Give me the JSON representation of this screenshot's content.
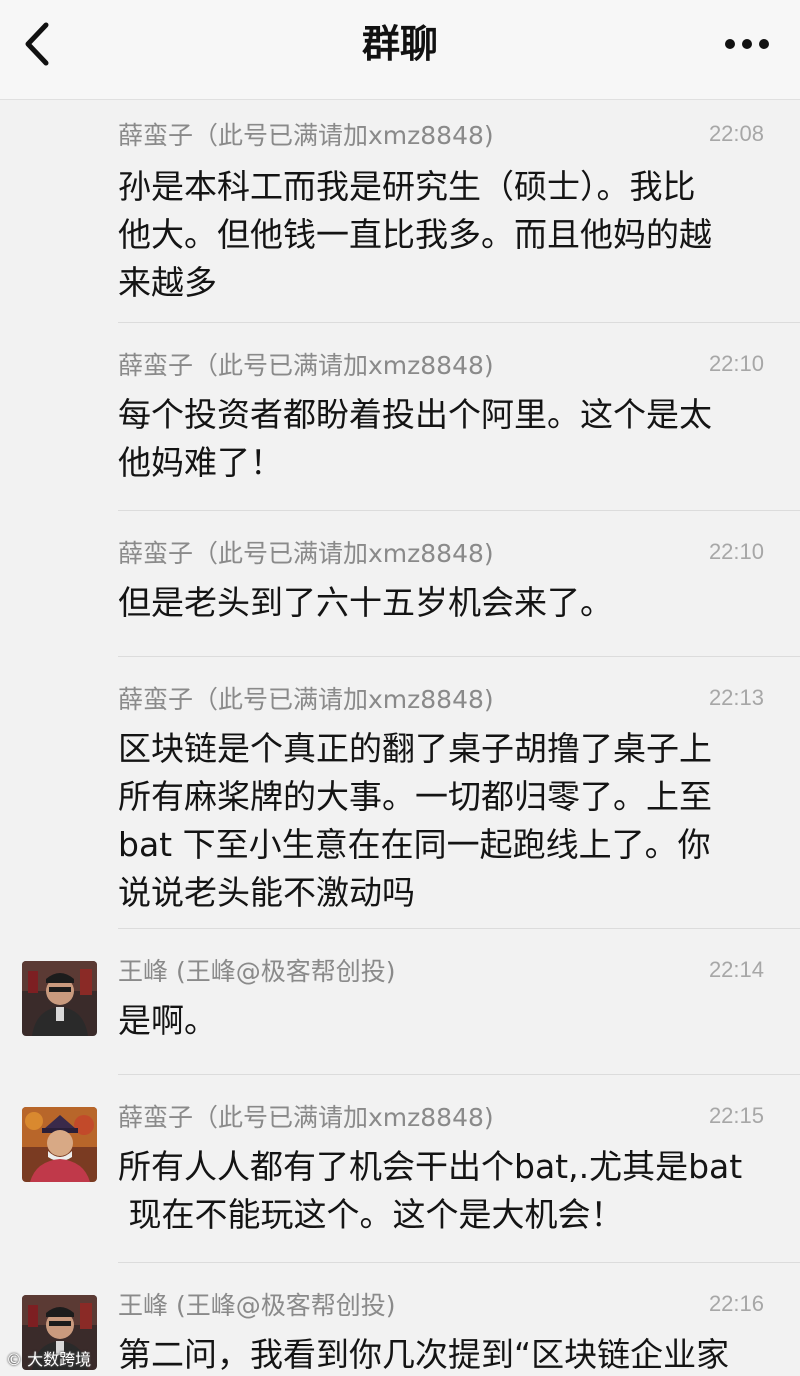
{
  "header": {
    "title": "群聊"
  },
  "messages": [
    {
      "sender": "薛蛮子（此号已满请加xmz8848)",
      "time": "22:08",
      "lines": [
        "孙是本科工而我是研究生（硕士）。我比",
        "他大。但他钱一直比我多。而且他妈的越",
        "来越多"
      ],
      "avatar_visible": false
    },
    {
      "sender": "薛蛮子（此号已满请加xmz8848)",
      "time": "22:10",
      "lines": [
        "每个投资者都盼着投出个阿里。这个是太",
        "他妈难了！"
      ],
      "avatar_visible": false
    },
    {
      "sender": "薛蛮子（此号已满请加xmz8848)",
      "time": "22:10",
      "lines": [
        "但是老头到了六十五岁机会来了。"
      ],
      "avatar_visible": false
    },
    {
      "sender": "薛蛮子（此号已满请加xmz8848)",
      "time": "22:13",
      "lines": [
        "区块链是个真正的翻了桌子胡撸了桌子上",
        "所有麻桨牌的大事。一切都归零了。上至",
        "bat 下至小生意在在同一起跑线上了。你",
        "说说老头能不激动吗"
      ],
      "avatar_visible": false
    },
    {
      "sender": "王峰 (王峰@极客帮创投)",
      "time": "22:14",
      "lines": [
        "是啊。"
      ],
      "avatar_visible": true
    },
    {
      "sender": "薛蛮子（此号已满请加xmz8848)",
      "time": "22:15",
      "lines": [
        "所有人人都有了机会干出个bat,.尤其是bat",
        " 现在不能玩这个。这个是大机会！"
      ],
      "avatar_visible": true
    },
    {
      "sender": "王峰 (王峰@极客帮创投)",
      "time": "22:16",
      "lines": [
        "第二问，我看到你几次提到“区块链企业家"
      ],
      "avatar_visible": true
    }
  ],
  "watermark": "大数跨境",
  "colors": {
    "navbar_bg": "#f7f7f7",
    "page_bg": "#f2f2f2",
    "sender_text": "#8a8a8a",
    "time_text": "#a7a7a7"
  }
}
